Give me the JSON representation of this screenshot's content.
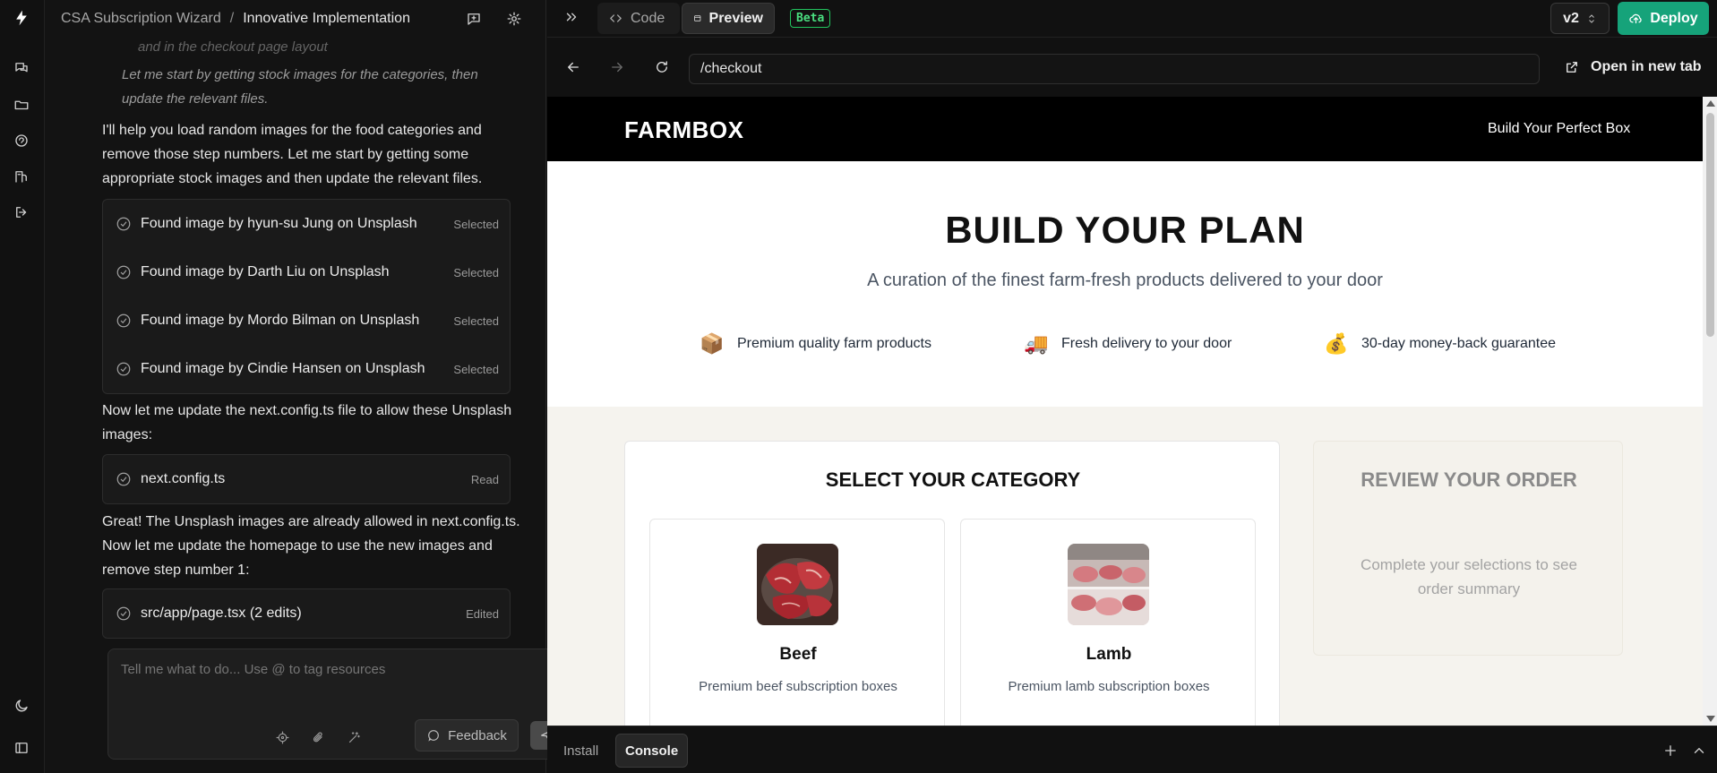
{
  "header": {
    "project": "CSA Subscription Wizard",
    "separator": "/",
    "chat_title": "Innovative Implementation"
  },
  "chat": {
    "thought_lines": [
      "and in the checkout page layout",
      "Let me start by getting stock images for the categories, then",
      "update the relevant files."
    ],
    "para_1": "I'll help you load random images for the food categories and remove those step numbers. Let me start by getting some appropriate stock images and then update the relevant files.",
    "images": [
      {
        "label": "Found image by hyun-su Jung on Unsplash",
        "status": "Selected"
      },
      {
        "label": "Found image by Darth Liu on Unsplash",
        "status": "Selected"
      },
      {
        "label": "Found image by Mordo Bilman on Unsplash",
        "status": "Selected"
      },
      {
        "label": "Found image by Cindie Hansen on Unsplash",
        "status": "Selected"
      }
    ],
    "para_2": "Now let me update the next.config.ts file to allow these Unsplash images:",
    "file_read": {
      "label": "next.config.ts",
      "status": "Read"
    },
    "para_3": "Great! The Unsplash images are already allowed in next.config.ts. Now let me update the homepage to use the new images and remove step number 1:",
    "file_edit": {
      "label": "src/app/page.tsx (2 edits)",
      "status": "Edited"
    }
  },
  "composer": {
    "placeholder": "Tell me what to do... Use @ to tag resources",
    "feedback_label": "Feedback"
  },
  "toolbar": {
    "code_label": "Code",
    "preview_label": "Preview",
    "beta_label": "Beta",
    "version": "v2",
    "deploy_label": "Deploy"
  },
  "urlbar": {
    "path": "/checkout",
    "open_new_tab": "Open in new tab"
  },
  "site": {
    "logo": "FARMBOX",
    "nav_link": "Build Your Perfect Box",
    "hero_title": "BUILD YOUR PLAN",
    "hero_subtitle": "A curation of the finest farm-fresh products delivered to your door",
    "features": [
      {
        "icon": "package-icon",
        "emoji": "📦",
        "text": "Premium quality farm products"
      },
      {
        "icon": "truck-icon",
        "emoji": "🚚",
        "text": "Fresh delivery to your door"
      },
      {
        "icon": "money-bag-icon",
        "emoji": "💰",
        "text": "30-day money-back guarantee"
      }
    ],
    "category_title": "SELECT YOUR CATEGORY",
    "categories": [
      {
        "name": "Beef",
        "desc": "Premium beef subscription boxes"
      },
      {
        "name": "Lamb",
        "desc": "Premium lamb subscription boxes"
      }
    ],
    "review_title": "REVIEW YOUR ORDER",
    "review_text": "Complete your selections to see order summary"
  },
  "console": {
    "install_label": "Install",
    "console_label": "Console"
  },
  "colors": {
    "deploy": "#16a37a",
    "beta": "#4ade80",
    "site_bg": "#f5f3ee"
  }
}
